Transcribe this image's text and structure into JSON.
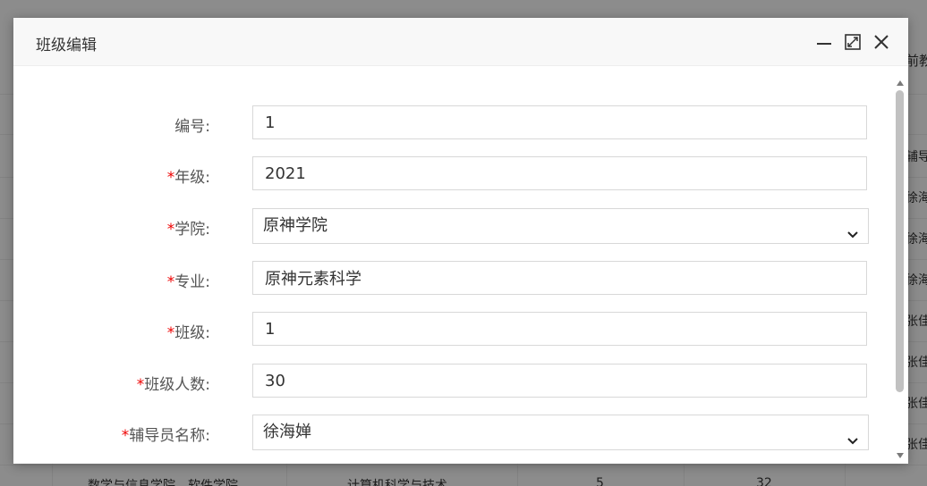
{
  "background": {
    "right_texts": [
      "前教",
      "辅导",
      "徐海",
      "徐海",
      "徐海",
      "张佳",
      "张佳",
      "张佳",
      "张佳"
    ],
    "bottom_row": [
      "数学与信息学院、软件学院",
      "计算机科学与技术",
      "5",
      "32"
    ]
  },
  "dialog": {
    "title": "班级编辑",
    "minimize_icon": "minimize-icon",
    "maximize_icon": "maximize-icon",
    "close_icon": "close-icon"
  },
  "form": {
    "id": {
      "label": "编号:",
      "required": false,
      "value": "1"
    },
    "grade": {
      "label": "年级:",
      "required": true,
      "value": "2021"
    },
    "college": {
      "label": "学院:",
      "required": true,
      "value": "原神学院"
    },
    "major": {
      "label": "专业:",
      "required": true,
      "value": "原神元素科学"
    },
    "class": {
      "label": "班级:",
      "required": true,
      "value": "1"
    },
    "count": {
      "label": "班级人数:",
      "required": true,
      "value": "30"
    },
    "counselor": {
      "label": "辅导员名称:",
      "required": true,
      "value": "徐海婵"
    },
    "required_mark": "*"
  },
  "colors": {
    "required": "#e00000",
    "overlay": "rgba(0,0,0,0.42)"
  }
}
